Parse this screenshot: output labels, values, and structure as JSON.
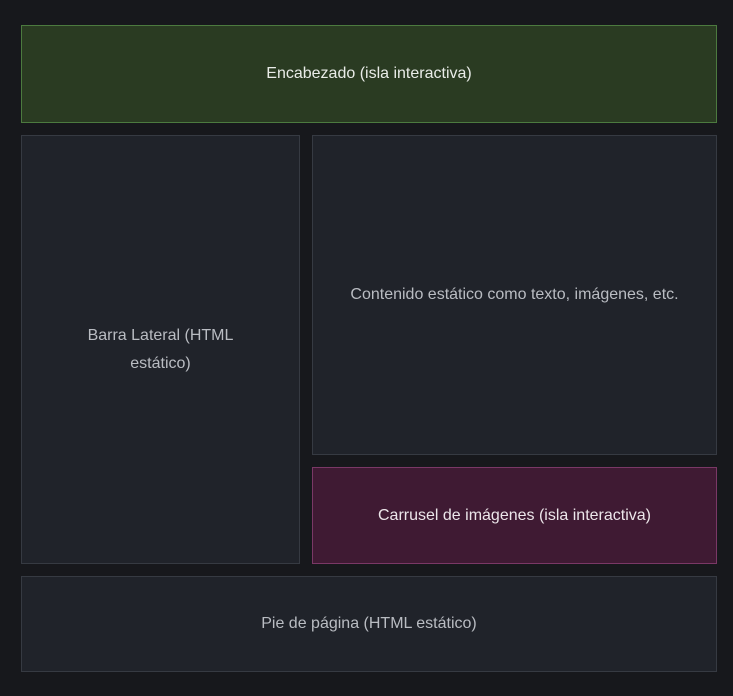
{
  "header": {
    "label": "Encabezado (isla interactiva)"
  },
  "sidebar": {
    "label": "Barra Lateral (HTML estático)"
  },
  "content": {
    "label": "Contenido estático como texto, imágenes, etc."
  },
  "carousel": {
    "label": "Carrusel de imágenes (isla interactiva)"
  },
  "footer": {
    "label": "Pie de página (HTML estático)"
  },
  "colors": {
    "background": "#17181c",
    "interactive_island_green": "#2a3b22",
    "interactive_island_purple": "#3f1a33",
    "static_block": "#20232a"
  }
}
